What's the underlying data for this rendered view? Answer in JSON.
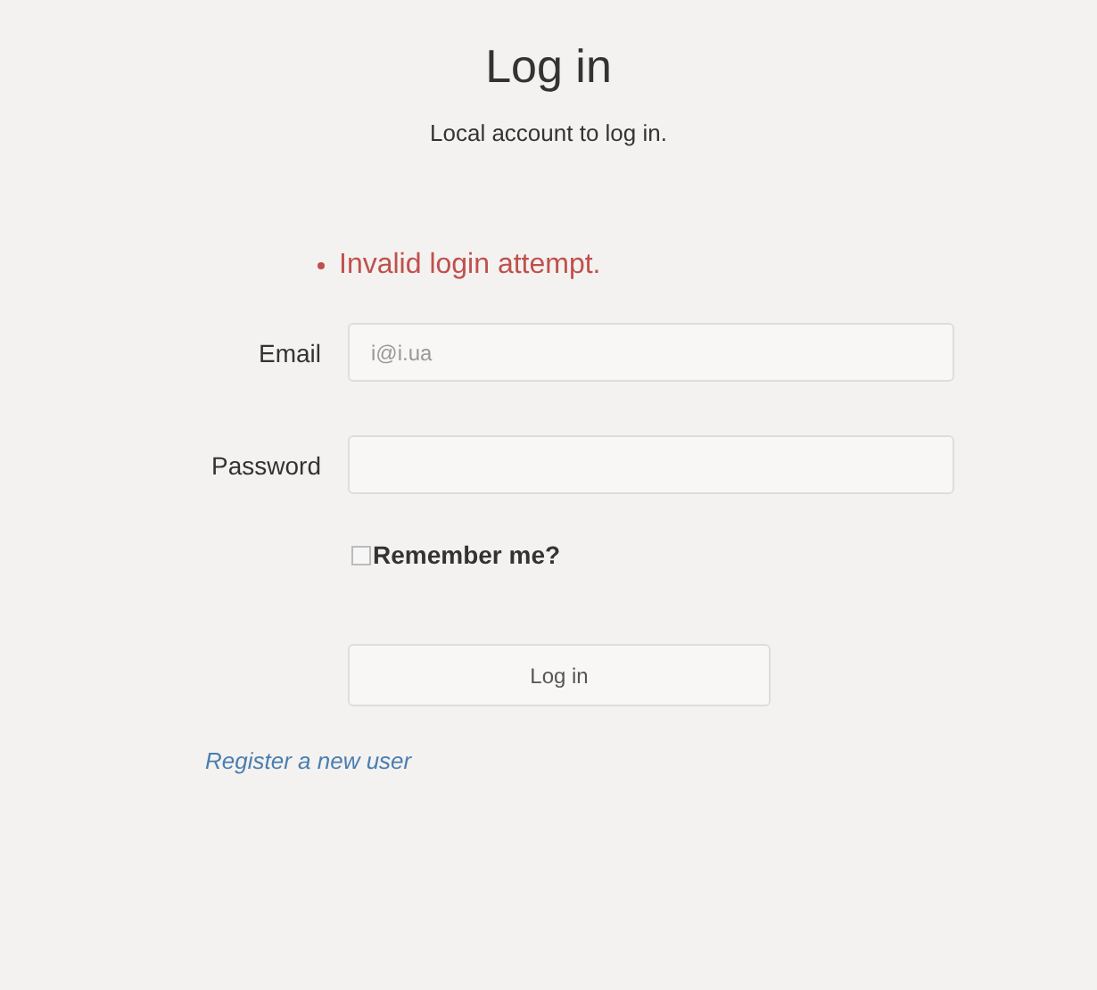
{
  "title": "Log in",
  "subtitle": "Local account to log in.",
  "errors": [
    "Invalid login attempt."
  ],
  "fields": [
    {
      "label": "Email",
      "value": "i@i.ua",
      "kind": "text"
    },
    {
      "label": "Password",
      "kind": "password"
    }
  ],
  "remember": {
    "label": "Remember me?",
    "checked": false
  },
  "submit": "Log in",
  "register_link": "Register a new user"
}
